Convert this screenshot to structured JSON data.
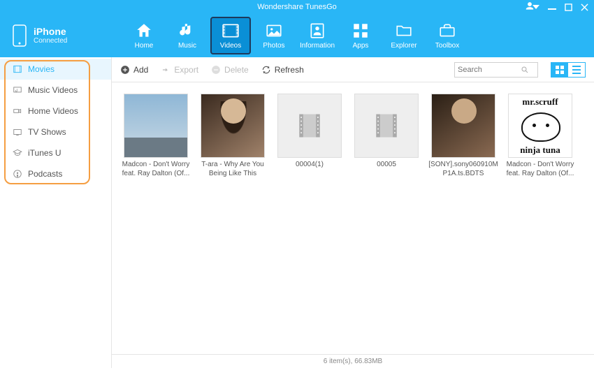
{
  "window": {
    "title": "Wondershare TunesGo"
  },
  "device": {
    "name": "iPhone",
    "status": "Connected"
  },
  "nav": [
    {
      "label": "Home",
      "icon": "home"
    },
    {
      "label": "Music",
      "icon": "music"
    },
    {
      "label": "Videos",
      "icon": "film",
      "active": true
    },
    {
      "label": "Photos",
      "icon": "image"
    },
    {
      "label": "Information",
      "icon": "contacts"
    },
    {
      "label": "Apps",
      "icon": "apps"
    },
    {
      "label": "Explorer",
      "icon": "folder"
    },
    {
      "label": "Toolbox",
      "icon": "toolbox"
    }
  ],
  "sidebar": [
    {
      "label": "Movies",
      "icon": "film",
      "active": true
    },
    {
      "label": "Music Videos",
      "icon": "musicvid"
    },
    {
      "label": "Home Videos",
      "icon": "camcorder"
    },
    {
      "label": "TV Shows",
      "icon": "tv"
    },
    {
      "label": "iTunes U",
      "icon": "gradcap"
    },
    {
      "label": "Podcasts",
      "icon": "podcast"
    }
  ],
  "toolbar": {
    "add": "Add",
    "export": "Export",
    "delete": "Delete",
    "refresh": "Refresh",
    "search_placeholder": "Search"
  },
  "scruff": {
    "top": "mr.scruff",
    "bottom": "ninja tuna"
  },
  "items": [
    {
      "label": "Madcon - Don't Worry feat. Ray Dalton (Of...",
      "thumb": "sky"
    },
    {
      "label": "T-ara - Why Are You Being Like This",
      "thumb": "leona"
    },
    {
      "label": "00004(1)",
      "thumb": "placeholder"
    },
    {
      "label": "00005",
      "thumb": "placeholder"
    },
    {
      "label": "[SONY].sony060910MP1A.ts.BDTS",
      "thumb": "sony"
    },
    {
      "label": "Madcon - Don't Worry feat. Ray Dalton (Of...",
      "thumb": "scruff"
    }
  ],
  "status": "6 item(s), 66.83MB"
}
